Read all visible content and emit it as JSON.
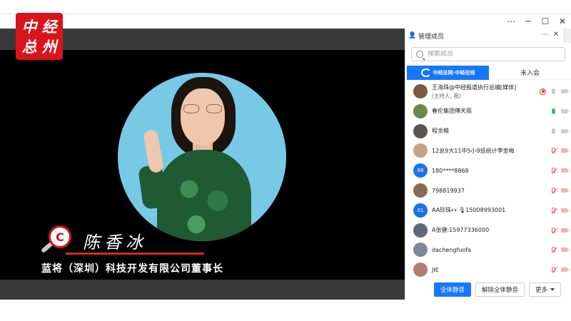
{
  "logo": {
    "chars": [
      "中",
      "经",
      "总",
      "州"
    ]
  },
  "window": {
    "menu_icon": "⋯",
    "minimize_icon": "─",
    "maximize_icon": "☐",
    "close_icon": "✕"
  },
  "video": {
    "speaker_name": "陈香冰",
    "speaker_title": "蓝将（深圳）科技开发有限公司董事长",
    "badge_letter": "C"
  },
  "panel": {
    "title": "管理成员",
    "header_more": "⋯",
    "header_close": "✕",
    "search_placeholder": "搜索成员",
    "tabs": [
      {
        "label": "中经总网·中经在线",
        "active": true
      },
      {
        "label": "未入会",
        "active": false
      }
    ],
    "members": [
      {
        "name": "王海珠@中经报道执行总编[媒体]",
        "sub": "(主持人, 我)",
        "avatar": "",
        "avatar_color": "#7a5a3e",
        "recording": true,
        "mic": "off",
        "cam": "off"
      },
      {
        "name": "春伦集团傅天雨",
        "sub": "",
        "avatar": "",
        "avatar_color": "#6a8a4a",
        "recording": false,
        "mic": "active",
        "cam": "off"
      },
      {
        "name": "程余粮",
        "sub": "",
        "avatar": "",
        "avatar_color": "#5a5550",
        "recording": false,
        "mic": "off",
        "cam": "off"
      },
      {
        "name": "12总9大11中5小9班统计李金梅",
        "sub": "",
        "avatar": "",
        "avatar_color": "#c9a08a",
        "recording": false,
        "mic": "muted",
        "cam": "muted"
      },
      {
        "name": "180****8868",
        "sub": "",
        "avatar": "68",
        "avatar_color": "#1a73e8",
        "recording": false,
        "mic": "muted",
        "cam": "muted"
      },
      {
        "name": "798819937",
        "sub": "",
        "avatar": "",
        "avatar_color": "#8a6a50",
        "recording": false,
        "mic": "muted",
        "cam": "muted"
      },
      {
        "name": "AA珍珠👀🎙15008993001",
        "sub": "",
        "avatar": "01",
        "avatar_color": "#1a73e8",
        "recording": false,
        "mic": "muted",
        "cam": "muted"
      },
      {
        "name": "A张健:15977336000",
        "sub": "",
        "avatar": "",
        "avatar_color": "#5a6a7a",
        "recording": false,
        "mic": "muted",
        "cam": "muted"
      },
      {
        "name": "dachengfuofa",
        "sub": "",
        "avatar": "",
        "avatar_color": "#7a8a9a",
        "recording": false,
        "mic": "muted",
        "cam": "muted"
      },
      {
        "name": "JIE",
        "sub": "",
        "avatar": "",
        "avatar_color": "#b08070",
        "recording": false,
        "mic": "muted",
        "cam": "muted"
      }
    ],
    "footer": {
      "mute_all": "全体静音",
      "unmute_all": "解除全体静音",
      "more": "更多"
    }
  }
}
